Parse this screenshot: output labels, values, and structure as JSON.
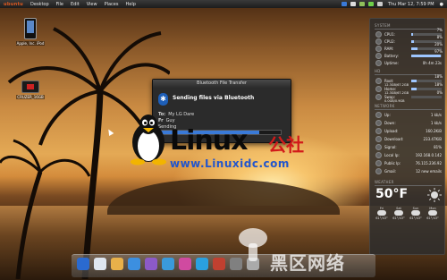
{
  "top_panel": {
    "logo": "ubuntu",
    "menus": [
      "Desktop",
      "File",
      "Edit",
      "View",
      "Places",
      "Help"
    ],
    "clock": "Thu Mar 12,  7:59 PM",
    "user_icon": "user-icon"
  },
  "desktop_icons": [
    {
      "label": "Apple, Inc. iPod",
      "icon": "ipod-icon"
    },
    {
      "label": "CRUZER_16GB",
      "icon": "usb-drive-icon"
    }
  ],
  "bluetooth_window": {
    "title": "Bluetooth File Transfer",
    "heading": "Sending files via Bluetooth",
    "to_label": "To:",
    "to_value": "My LG Dare",
    "from_label": "Fr",
    "from_value": "Guy",
    "status": "Sending",
    "progress": 0.82
  },
  "watermark": {
    "brand": "Linux",
    "brand_cn": "公社",
    "url": "www.Linuxidc.com",
    "bottom_cn": "黑区网络"
  },
  "sidebar": {
    "system_title": "SYSTEM",
    "system_rows": [
      {
        "label": "CPU1:",
        "value": "7%",
        "level": 0.07
      },
      {
        "label": "CPU2:",
        "value": "8%",
        "level": 0.08
      },
      {
        "label": "RAM:",
        "value": "20%",
        "level": 0.2
      },
      {
        "label": "Battery:",
        "value": "97%",
        "level": 0.97
      },
      {
        "label": "Uptime:",
        "value": "0h 4m 23s",
        "level": null
      }
    ],
    "hd_title": "HD",
    "hd_rows": [
      {
        "label": "Root:",
        "value": "18%",
        "sub": "12.3GB/67.2GB",
        "level": 0.18
      },
      {
        "label": "Home:",
        "value": "18%",
        "sub": "12.3GB/67.2GB",
        "level": 0.18
      },
      {
        "label": "Swap:",
        "value": "0%",
        "sub": "0.0GB/0.9GB",
        "level": 0.0
      }
    ],
    "network_title": "NETWORK",
    "network_rows": [
      {
        "label": "Up:",
        "value": "1 kb/s"
      },
      {
        "label": "Down:",
        "value": "1 kb/s"
      },
      {
        "label": "Upload:",
        "value": "160.2KiB"
      },
      {
        "label": "Download:",
        "value": "233.47KiB"
      },
      {
        "label": "Signal:",
        "value": "81%"
      },
      {
        "label": "Local Ip:",
        "value": "192.168.0.142"
      },
      {
        "label": "Public Ip:",
        "value": "76.115.236.92"
      },
      {
        "label": "Gmail:",
        "value": "12 new emails"
      }
    ],
    "weather_title": "WEATHER",
    "temperature": "50°F",
    "forecast": [
      {
        "day": "Fri",
        "temp": "61°/43°"
      },
      {
        "day": "Sat",
        "temp": "61°/43°"
      },
      {
        "day": "Sun",
        "temp": "61°/43°"
      },
      {
        "day": "Mon",
        "temp": "61°/43°"
      }
    ]
  },
  "dock_icons": [
    "start-icon",
    "home-icon",
    "folder-icon",
    "firefox-icon",
    "pidgin-icon",
    "download-icon",
    "chat-icon",
    "skype-icon",
    "music-icon",
    "settings-icon",
    "trash-icon"
  ],
  "colors": {
    "panel_bg": "#1c1c1c",
    "logo": "#e05a20",
    "accent": "#3a7ad8",
    "watermark_red": "#d21a1a",
    "url_blue": "#2255cc"
  }
}
